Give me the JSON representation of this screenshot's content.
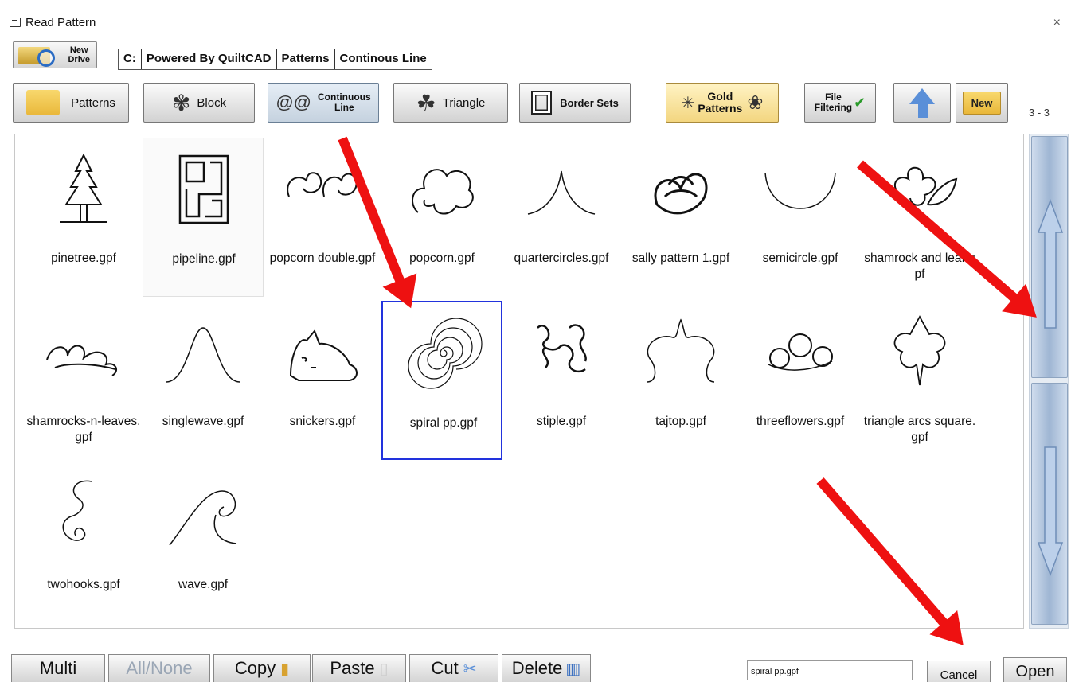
{
  "window": {
    "title": "Read Pattern",
    "close": "×"
  },
  "drive_button": {
    "label_line1": "New",
    "label_line2": "Drive"
  },
  "path": [
    "C:",
    "Powered By QuiltCAD",
    "Patterns",
    "Continous Line"
  ],
  "toolbar": {
    "patterns": "Patterns",
    "block": "Block",
    "continuous_line1": "Continuous",
    "continuous_line2": "Line",
    "triangle": "Triangle",
    "border_sets": "Border Sets",
    "gold_line1": "Gold",
    "gold_line2": "Patterns",
    "file_filter_line1": "File",
    "file_filter_line2": "Filtering",
    "new": "New"
  },
  "page_indicator": "3 - 3",
  "files": [
    {
      "name": "pinetree.gpf",
      "icon": "pine-tree-icon"
    },
    {
      "name": "pipeline.gpf",
      "icon": "pipeline-maze-icon"
    },
    {
      "name": "popcorn double.gpf",
      "icon": "double-popcorn-icon"
    },
    {
      "name": "popcorn.gpf",
      "icon": "popcorn-icon"
    },
    {
      "name": "quartercircles.gpf",
      "icon": "quarter-circles-icon"
    },
    {
      "name": "sally pattern 1.gpf",
      "icon": "sally-pattern-icon"
    },
    {
      "name": "semicircle.gpf",
      "icon": "semicircle-icon"
    },
    {
      "name": "shamrock and leaf.gpf",
      "icon": "shamrock-leaf-icon"
    },
    {
      "name": "shamrocks-n-leaves.gpf",
      "icon": "shamrocks-leaves-icon"
    },
    {
      "name": "singlewave.gpf",
      "icon": "single-wave-icon"
    },
    {
      "name": "snickers.gpf",
      "icon": "cat-icon"
    },
    {
      "name": "spiral pp.gpf",
      "icon": "spiral-icon"
    },
    {
      "name": "stiple.gpf",
      "icon": "stipple-icon"
    },
    {
      "name": "tajtop.gpf",
      "icon": "tajtop-icon"
    },
    {
      "name": "threeflowers.gpf",
      "icon": "three-flowers-icon"
    },
    {
      "name": "triangle arcs square.gpf",
      "icon": "triangle-arcs-icon"
    },
    {
      "name": "twohooks.gpf",
      "icon": "two-hooks-icon"
    },
    {
      "name": "wave.gpf",
      "icon": "wave-icon"
    }
  ],
  "bottom": {
    "multi": "Multi",
    "all_none": "All/None",
    "copy": "Copy",
    "paste": "Paste",
    "cut": "Cut",
    "delete": "Delete",
    "filename_value": "spiral pp.gpf",
    "cancel": "Cancel",
    "open": "Open"
  },
  "colors": {
    "selection": "#2233dd",
    "annotation_arrow": "#ee1111",
    "scrollbar": "#9fb6d3"
  }
}
